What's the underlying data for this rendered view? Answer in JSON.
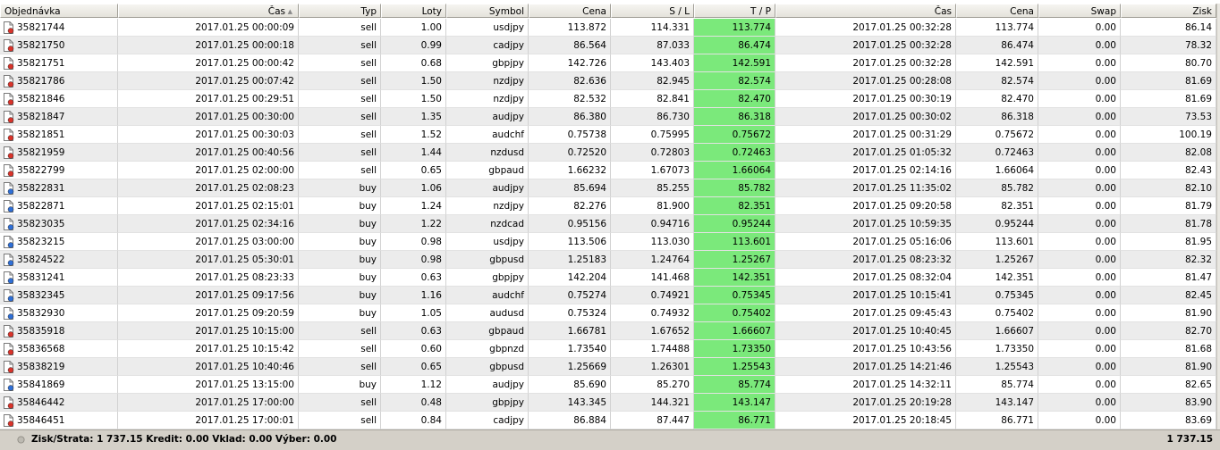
{
  "columns": [
    {
      "key": "order",
      "label": "Objednávka",
      "align": "l"
    },
    {
      "key": "time_open",
      "label": "Čas",
      "align": "r",
      "sort": true
    },
    {
      "key": "type",
      "label": "Typ",
      "align": "r"
    },
    {
      "key": "lots",
      "label": "Loty",
      "align": "r"
    },
    {
      "key": "symbol",
      "label": "Symbol",
      "align": "r"
    },
    {
      "key": "price_open",
      "label": "Cena",
      "align": "r"
    },
    {
      "key": "sl",
      "label": "S / L",
      "align": "r"
    },
    {
      "key": "tp",
      "label": "T / P",
      "align": "r"
    },
    {
      "key": "time_close",
      "label": "Čas",
      "align": "r"
    },
    {
      "key": "price_close",
      "label": "Cena",
      "align": "r"
    },
    {
      "key": "swap",
      "label": "Swap",
      "align": "r"
    },
    {
      "key": "profit",
      "label": "Zisk",
      "align": "r"
    }
  ],
  "sort_indicator": "▲",
  "rows": [
    [
      "35821744",
      "2017.01.25 00:00:09",
      "sell",
      "1.00",
      "usdjpy",
      "113.872",
      "114.331",
      "113.774",
      "2017.01.25 00:32:28",
      "113.774",
      "0.00",
      "86.14"
    ],
    [
      "35821750",
      "2017.01.25 00:00:18",
      "sell",
      "0.99",
      "cadjpy",
      "86.564",
      "87.033",
      "86.474",
      "2017.01.25 00:32:28",
      "86.474",
      "0.00",
      "78.32"
    ],
    [
      "35821751",
      "2017.01.25 00:00:42",
      "sell",
      "0.68",
      "gbpjpy",
      "142.726",
      "143.403",
      "142.591",
      "2017.01.25 00:32:28",
      "142.591",
      "0.00",
      "80.70"
    ],
    [
      "35821786",
      "2017.01.25 00:07:42",
      "sell",
      "1.50",
      "nzdjpy",
      "82.636",
      "82.945",
      "82.574",
      "2017.01.25 00:28:08",
      "82.574",
      "0.00",
      "81.69"
    ],
    [
      "35821846",
      "2017.01.25 00:29:51",
      "sell",
      "1.50",
      "nzdjpy",
      "82.532",
      "82.841",
      "82.470",
      "2017.01.25 00:30:19",
      "82.470",
      "0.00",
      "81.69"
    ],
    [
      "35821847",
      "2017.01.25 00:30:00",
      "sell",
      "1.35",
      "audjpy",
      "86.380",
      "86.730",
      "86.318",
      "2017.01.25 00:30:02",
      "86.318",
      "0.00",
      "73.53"
    ],
    [
      "35821851",
      "2017.01.25 00:30:03",
      "sell",
      "1.52",
      "audchf",
      "0.75738",
      "0.75995",
      "0.75672",
      "2017.01.25 00:31:29",
      "0.75672",
      "0.00",
      "100.19"
    ],
    [
      "35821959",
      "2017.01.25 00:40:56",
      "sell",
      "1.44",
      "nzdusd",
      "0.72520",
      "0.72803",
      "0.72463",
      "2017.01.25 01:05:32",
      "0.72463",
      "0.00",
      "82.08"
    ],
    [
      "35822799",
      "2017.01.25 02:00:00",
      "sell",
      "0.65",
      "gbpaud",
      "1.66232",
      "1.67073",
      "1.66064",
      "2017.01.25 02:14:16",
      "1.66064",
      "0.00",
      "82.43"
    ],
    [
      "35822831",
      "2017.01.25 02:08:23",
      "buy",
      "1.06",
      "audjpy",
      "85.694",
      "85.255",
      "85.782",
      "2017.01.25 11:35:02",
      "85.782",
      "0.00",
      "82.10"
    ],
    [
      "35822871",
      "2017.01.25 02:15:01",
      "buy",
      "1.24",
      "nzdjpy",
      "82.276",
      "81.900",
      "82.351",
      "2017.01.25 09:20:58",
      "82.351",
      "0.00",
      "81.79"
    ],
    [
      "35823035",
      "2017.01.25 02:34:16",
      "buy",
      "1.22",
      "nzdcad",
      "0.95156",
      "0.94716",
      "0.95244",
      "2017.01.25 10:59:35",
      "0.95244",
      "0.00",
      "81.78"
    ],
    [
      "35823215",
      "2017.01.25 03:00:00",
      "buy",
      "0.98",
      "usdjpy",
      "113.506",
      "113.030",
      "113.601",
      "2017.01.25 05:16:06",
      "113.601",
      "0.00",
      "81.95"
    ],
    [
      "35824522",
      "2017.01.25 05:30:01",
      "buy",
      "0.98",
      "gbpusd",
      "1.25183",
      "1.24764",
      "1.25267",
      "2017.01.25 08:23:32",
      "1.25267",
      "0.00",
      "82.32"
    ],
    [
      "35831241",
      "2017.01.25 08:23:33",
      "buy",
      "0.63",
      "gbpjpy",
      "142.204",
      "141.468",
      "142.351",
      "2017.01.25 08:32:04",
      "142.351",
      "0.00",
      "81.47"
    ],
    [
      "35832345",
      "2017.01.25 09:17:56",
      "buy",
      "1.16",
      "audchf",
      "0.75274",
      "0.74921",
      "0.75345",
      "2017.01.25 10:15:41",
      "0.75345",
      "0.00",
      "82.45"
    ],
    [
      "35832930",
      "2017.01.25 09:20:59",
      "buy",
      "1.05",
      "audusd",
      "0.75324",
      "0.74932",
      "0.75402",
      "2017.01.25 09:45:43",
      "0.75402",
      "0.00",
      "81.90"
    ],
    [
      "35835918",
      "2017.01.25 10:15:00",
      "sell",
      "0.63",
      "gbpaud",
      "1.66781",
      "1.67652",
      "1.66607",
      "2017.01.25 10:40:45",
      "1.66607",
      "0.00",
      "82.70"
    ],
    [
      "35836568",
      "2017.01.25 10:15:42",
      "sell",
      "0.60",
      "gbpnzd",
      "1.73540",
      "1.74488",
      "1.73350",
      "2017.01.25 10:43:56",
      "1.73350",
      "0.00",
      "81.68"
    ],
    [
      "35838219",
      "2017.01.25 10:40:46",
      "sell",
      "0.65",
      "gbpusd",
      "1.25669",
      "1.26301",
      "1.25543",
      "2017.01.25 14:21:46",
      "1.25543",
      "0.00",
      "81.90"
    ],
    [
      "35841869",
      "2017.01.25 13:15:00",
      "buy",
      "1.12",
      "audjpy",
      "85.690",
      "85.270",
      "85.774",
      "2017.01.25 14:32:11",
      "85.774",
      "0.00",
      "82.65"
    ],
    [
      "35846442",
      "2017.01.25 17:00:00",
      "sell",
      "0.48",
      "gbpjpy",
      "143.345",
      "144.321",
      "143.147",
      "2017.01.25 20:19:28",
      "143.147",
      "0.00",
      "83.90"
    ],
    [
      "35846451",
      "2017.01.25 17:00:01",
      "sell",
      "0.84",
      "cadjpy",
      "86.884",
      "87.447",
      "86.771",
      "2017.01.25 20:18:45",
      "86.771",
      "0.00",
      "83.69"
    ]
  ],
  "footer": {
    "summary": "Zisk/Strata: 1 737.15  Kredit: 0.00  Vklad: 0.00  Výber: 0.00",
    "total": "1 737.15"
  },
  "colors": {
    "tp_highlight": "#7be97b",
    "sell_icon": "#d9342b",
    "buy_icon": "#2f6fd6"
  },
  "icons": {
    "sell": "sell-order-icon",
    "buy": "buy-order-icon",
    "footer": "balance-status-icon"
  }
}
